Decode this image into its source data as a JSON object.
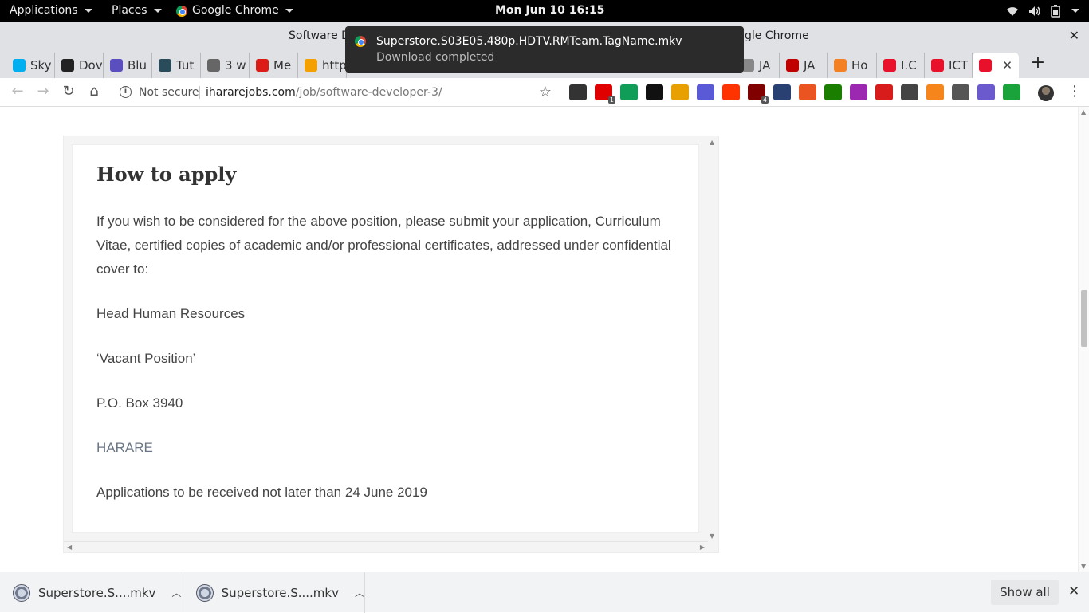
{
  "topbar": {
    "applications": "Applications",
    "places": "Places",
    "app_name": "Google Chrome",
    "clock": "Mon Jun 10  16:15"
  },
  "window": {
    "title_left": "Software D",
    "title_right": "gle Chrome",
    "close": "✕"
  },
  "tabs": [
    {
      "label": "Sky",
      "favicon_color": "#00aff0"
    },
    {
      "label": "Dov",
      "favicon_color": "#222222"
    },
    {
      "label": "Blu",
      "favicon_color": "#5b4fbf"
    },
    {
      "label": "Tut",
      "favicon_color": "#2a4b5a"
    },
    {
      "label": "3 w",
      "favicon_color": "#666666"
    },
    {
      "label": "Me",
      "favicon_color": "#dd1b16"
    },
    {
      "label": "http",
      "favicon_color": "#f4a000"
    },
    {
      "label": "JA",
      "favicon_color": "#888888"
    },
    {
      "label": "JA",
      "favicon_color": "#c00000"
    },
    {
      "label": "Ho",
      "favicon_color": "#f48024"
    },
    {
      "label": "I.C",
      "favicon_color": "#e8102a"
    },
    {
      "label": "ICT",
      "favicon_color": "#e8102a"
    },
    {
      "label": "",
      "favicon_color": "#e8102a"
    }
  ],
  "tab_close": "✕",
  "new_tab": "+",
  "omnibox": {
    "security": "Not secure",
    "host": "ihararejobs.com",
    "path": "/job/software-developer-3/"
  },
  "extensions": [
    {
      "name": "apps-grid-icon",
      "color": "#333333",
      "badge": ""
    },
    {
      "name": "opera-icon",
      "color": "#e00000",
      "badge": "1"
    },
    {
      "name": "drive-icon",
      "color": "#0f9d58",
      "badge": ""
    },
    {
      "name": "jetbrains-icon",
      "color": "#111111",
      "badge": ""
    },
    {
      "name": "dots-icon",
      "color": "#e8a000",
      "badge": ""
    },
    {
      "name": "jh-icon",
      "color": "#5a5ad6",
      "badge": ""
    },
    {
      "name": "wfm-icon",
      "color": "#ff3300",
      "badge": ""
    },
    {
      "name": "ublock-icon",
      "color": "#800000",
      "badge": "4"
    },
    {
      "name": "fedora-icon",
      "color": "#294172",
      "badge": ""
    },
    {
      "name": "ubuntu-icon",
      "color": "#e95420",
      "badge": ""
    },
    {
      "name": "bw-icon",
      "color": "#1a7f00",
      "badge": ""
    },
    {
      "name": "colorwheel-icon",
      "color": "#9c27b0",
      "badge": ""
    },
    {
      "name": "off-icon",
      "color": "#d81b1b",
      "badge": ""
    },
    {
      "name": "page-icon",
      "color": "#444444",
      "badge": ""
    },
    {
      "name": "metamask-icon",
      "color": "#f6851b",
      "badge": ""
    },
    {
      "name": "a-icon",
      "color": "#555555",
      "badge": ""
    },
    {
      "name": "r-icon",
      "color": "#6a5acd",
      "badge": ""
    },
    {
      "name": "shield-icon",
      "color": "#1aa33b",
      "badge": ""
    }
  ],
  "notification": {
    "filename": "Superstore.S03E05.480p.HDTV.RMTeam.TagName.mkv",
    "status": "Download completed"
  },
  "content": {
    "heading": "How to apply",
    "paragraph": "If you wish to be considered for the above position, please submit your application, Curriculum Vitae,  certified copies of academic and/or professional certificates, addressed under confidential cover to:",
    "line1": "Head Human Resources",
    "line2": "‘Vacant Position’",
    "line3": "P.O. Box 3940",
    "line4": "HARARE",
    "line5": "Applications to be received not later than 24 June 2019"
  },
  "downloads": [
    {
      "label": "Superstore.S....mkv"
    },
    {
      "label": "Superstore.S....mkv"
    }
  ],
  "shelf": {
    "show_all": "Show all",
    "close": "✕"
  }
}
